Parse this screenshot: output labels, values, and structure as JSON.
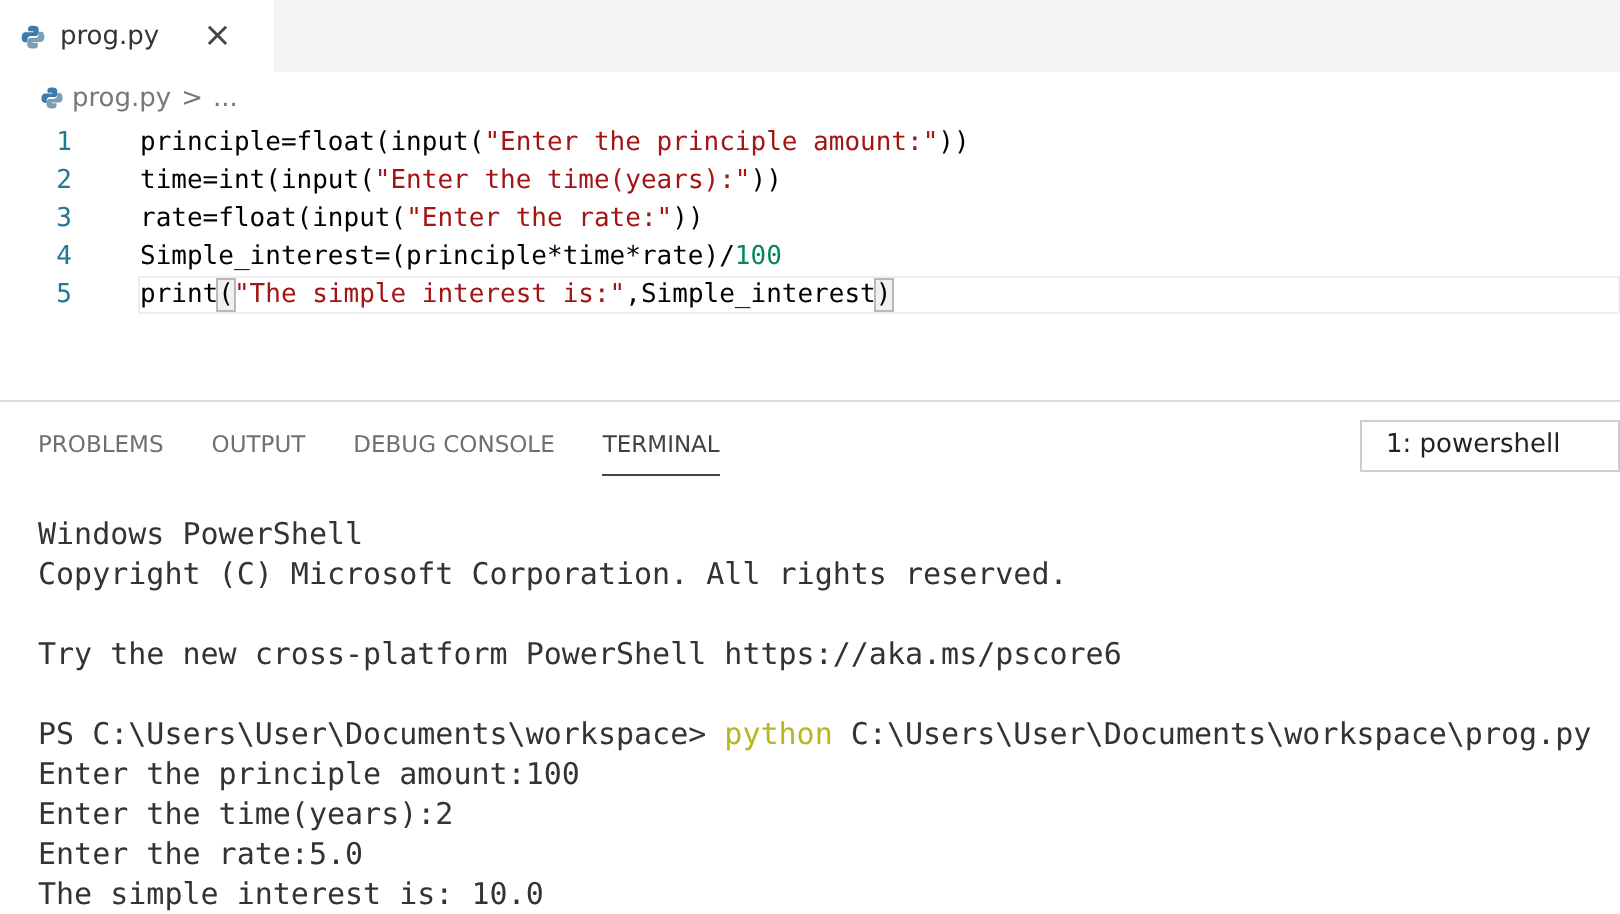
{
  "editor_tabs": [
    {
      "label": "prog.py",
      "selected": true,
      "close": "×"
    }
  ],
  "breadcrumb": {
    "file": "prog.py",
    "separator": ">",
    "rest": "..."
  },
  "code_lines": [
    {
      "number": "1",
      "current": false,
      "tokens": [
        {
          "kind": "plain",
          "text": "principle=float(input("
        },
        {
          "kind": "string",
          "text": "\"Enter the principle amount:\""
        },
        {
          "kind": "plain",
          "text": "))"
        }
      ]
    },
    {
      "number": "2",
      "current": false,
      "tokens": [
        {
          "kind": "plain",
          "text": "time=int(input("
        },
        {
          "kind": "string",
          "text": "\"Enter the time(years):\""
        },
        {
          "kind": "plain",
          "text": "))"
        }
      ]
    },
    {
      "number": "3",
      "current": false,
      "tokens": [
        {
          "kind": "plain",
          "text": "rate=float(input("
        },
        {
          "kind": "string",
          "text": "\"Enter the rate:\""
        },
        {
          "kind": "plain",
          "text": "))"
        }
      ]
    },
    {
      "number": "4",
      "current": false,
      "tokens": [
        {
          "kind": "plain",
          "text": "Simple_interest=(principle*time*rate)/"
        },
        {
          "kind": "number",
          "text": "100"
        }
      ]
    },
    {
      "number": "5",
      "current": true,
      "tokens": [
        {
          "kind": "plain",
          "text": "print"
        },
        {
          "kind": "bracket",
          "text": "("
        },
        {
          "kind": "string",
          "text": "\"The simple interest is:\""
        },
        {
          "kind": "plain",
          "text": ",Simple_interest"
        },
        {
          "kind": "bracket",
          "text": ")"
        }
      ]
    }
  ],
  "panel_tabs": [
    {
      "label": "PROBLEMS",
      "selected": false
    },
    {
      "label": "OUTPUT",
      "selected": false
    },
    {
      "label": "DEBUG CONSOLE",
      "selected": false
    },
    {
      "label": "TERMINAL",
      "selected": true
    }
  ],
  "terminal_selector": {
    "value": "1: powershell"
  },
  "terminal_blocks": [
    {
      "lines": [
        [
          {
            "kind": "output",
            "text": "Windows PowerShell"
          }
        ],
        [
          {
            "kind": "output",
            "text": "Copyright (C) Microsoft Corporation. All rights reserved."
          }
        ]
      ]
    },
    {
      "lines": [
        [
          {
            "kind": "output",
            "text": "Try the new cross-platform PowerShell https://aka.ms/pscore6"
          }
        ]
      ]
    },
    {
      "lines": [
        [
          {
            "kind": "output",
            "text": "PS C:\\Users\\User\\Documents\\workspace> "
          },
          {
            "kind": "command",
            "text": "python"
          },
          {
            "kind": "output",
            "text": " C:\\Users\\User\\Documents\\workspace\\prog.py"
          }
        ],
        [
          {
            "kind": "output",
            "text": "Enter the principle amount:100"
          }
        ],
        [
          {
            "kind": "output",
            "text": "Enter the time(years):2"
          }
        ],
        [
          {
            "kind": "output",
            "text": "Enter the rate:5.0"
          }
        ],
        [
          {
            "kind": "output",
            "text": "The simple interest is: 10.0"
          }
        ]
      ]
    }
  ]
}
